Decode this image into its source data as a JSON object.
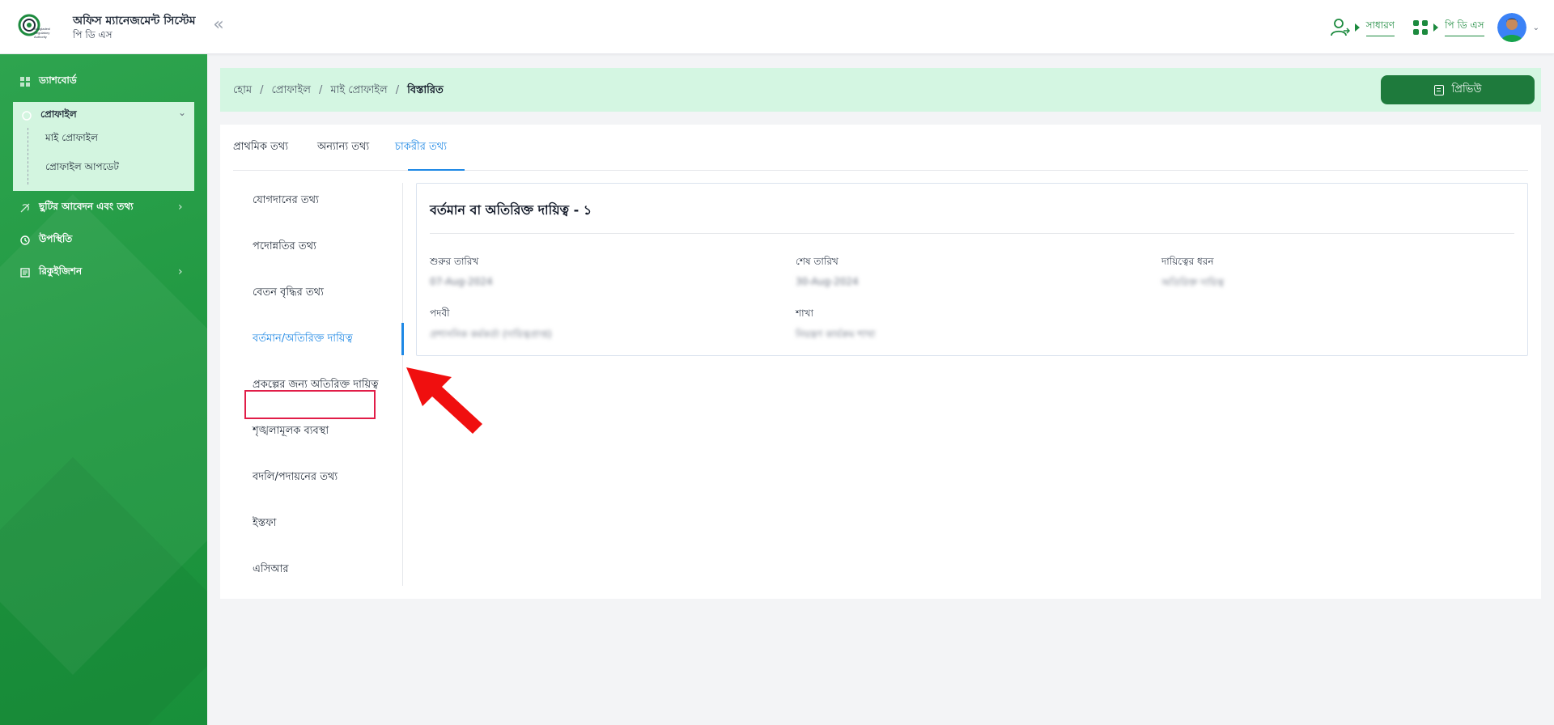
{
  "header": {
    "app_title": "অফিস ম্যানেজমেন্ট সিস্টেম",
    "app_subtitle": "পি ডি এস",
    "collapse_glyph": "«",
    "role_link": "সাধারণ",
    "module_link": "পি ডি এস",
    "logo_text": "Bangladesh Regulatory Authority"
  },
  "sidebar": {
    "dashboard": "ড্যাশবোর্ড",
    "profile": "প্রোফাইল",
    "profile_children": [
      "মাই প্রোফাইল",
      "প্রোফাইল আপডেট"
    ],
    "leave": "ছুটির আবেদন এবং তথ্য",
    "attendance": "উপস্থিতি",
    "requisition": "রিকুইজিশন"
  },
  "breadcrumb": {
    "items": [
      "হোম",
      "প্রোফাইল",
      "মাই প্রোফাইল"
    ],
    "separator": "/",
    "current": "বিস্তারিত"
  },
  "preview_button": "প্রিভিউ",
  "tabs": [
    "প্রাথমিক তথ্য",
    "অন্যান্য তথ্য",
    "চাকরীর তথ্য"
  ],
  "active_tab": "চাকরীর তথ্য",
  "subnav": [
    "যোগদানের তথ্য",
    "পদোন্নতির তথ্য",
    "বেতন বৃদ্ধির তথ্য",
    "বর্তমান/অতিরিক্ত দায়িত্ব",
    "প্রকল্পের জন্য অতিরিক্ত দায়িত্ব",
    "শৃঙ্খলামূলক ব্যবস্থা",
    "বদলি/পদায়নের তথ্য",
    "ইস্তফা",
    "এসিআর"
  ],
  "active_subnav": "বর্তমান/অতিরিক্ত দায়িত্ব",
  "detail": {
    "title": "বর্তমান বা অতিরিক্ত দায়িত্ব - ১",
    "labels": {
      "start_date": "শুরুর তারিখ",
      "end_date": "শেষ তারিখ",
      "duty_type": "দায়িত্বের ধরন",
      "designation": "পদবী",
      "branch": "শাখা"
    },
    "values": {
      "start_date": "07-Aug-2024",
      "end_date": "30-Aug-2024",
      "duty_type": "অতিরিক্ত দায়িত্ব",
      "designation": "প্রশাসনিক কর্মকর্তা (দায়িত্বপ্রাপ্ত)",
      "branch": "নিয়ন্ত্রণ কার্যক্রম শাখা"
    }
  },
  "colors": {
    "brand_green": "#1c8a3e",
    "sidebar_green": "#23a045",
    "active_blue": "#1e88e5",
    "highlight_red": "#e11d48",
    "crumb_bg": "#d4f6e2"
  }
}
